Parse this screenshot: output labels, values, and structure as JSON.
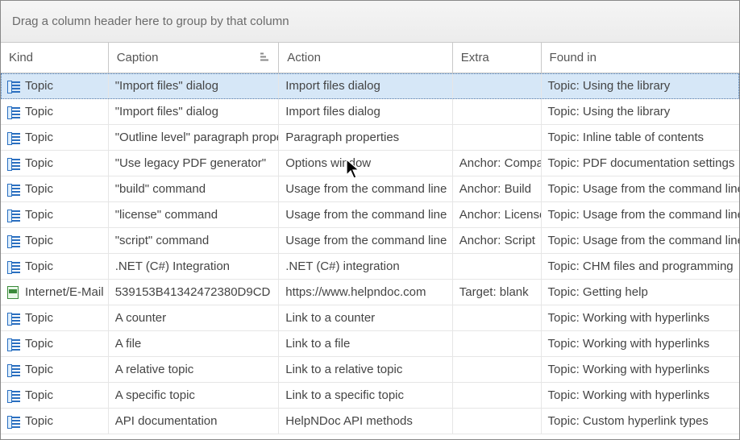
{
  "groupByHint": "Drag a column header here to group by that column",
  "columns": {
    "kind": "Kind",
    "caption": "Caption",
    "action": "Action",
    "extra": "Extra",
    "found": "Found in"
  },
  "rows": [
    {
      "kind": "Topic",
      "icon": "topic",
      "caption": "\"Import files\" dialog",
      "action": "Import files dialog",
      "extra": "",
      "found": "Topic: Using the library",
      "selected": true
    },
    {
      "kind": "Topic",
      "icon": "topic",
      "caption": "\"Import files\" dialog",
      "action": "Import files dialog",
      "extra": "",
      "found": "Topic: Using the library"
    },
    {
      "kind": "Topic",
      "icon": "topic",
      "caption": "\"Outline level\" paragraph property",
      "action": "Paragraph properties",
      "extra": "",
      "found": "Topic: Inline table of contents"
    },
    {
      "kind": "Topic",
      "icon": "topic",
      "caption": "\"Use legacy PDF generator\"",
      "action": "Options window",
      "extra": "Anchor: Compatibility",
      "found": "Topic: PDF documentation settings"
    },
    {
      "kind": "Topic",
      "icon": "topic",
      "caption": "\"build\" command",
      "action": "Usage from the command line",
      "extra": "Anchor: Build",
      "found": "Topic: Usage from the command line"
    },
    {
      "kind": "Topic",
      "icon": "topic",
      "caption": "\"license\" command",
      "action": "Usage from the command line",
      "extra": "Anchor: License",
      "found": "Topic: Usage from the command line"
    },
    {
      "kind": "Topic",
      "icon": "topic",
      "caption": "\"script\" command",
      "action": "Usage from the command line",
      "extra": "Anchor: Script",
      "found": "Topic: Usage from the command line"
    },
    {
      "kind": "Topic",
      "icon": "topic",
      "caption": ".NET (C#) Integration",
      "action": ".NET (C#) integration",
      "extra": "",
      "found": "Topic: CHM files and programming"
    },
    {
      "kind": "Internet/E-Mail",
      "icon": "html",
      "caption": "539153B41342472380D9CD",
      "action": "https://www.helpndoc.com",
      "extra": "Target: blank",
      "found": "Topic: Getting help"
    },
    {
      "kind": "Topic",
      "icon": "topic",
      "caption": "A counter",
      "action": "Link to a counter",
      "extra": "",
      "found": "Topic: Working with hyperlinks"
    },
    {
      "kind": "Topic",
      "icon": "topic",
      "caption": "A file",
      "action": "Link to a file",
      "extra": "",
      "found": "Topic: Working with hyperlinks"
    },
    {
      "kind": "Topic",
      "icon": "topic",
      "caption": "A relative topic",
      "action": "Link to a relative topic",
      "extra": "",
      "found": "Topic: Working with hyperlinks"
    },
    {
      "kind": "Topic",
      "icon": "topic",
      "caption": "A specific topic",
      "action": "Link to a specific topic",
      "extra": "",
      "found": "Topic: Working with hyperlinks"
    },
    {
      "kind": "Topic",
      "icon": "topic",
      "caption": "API documentation",
      "action": "HelpNDoc API methods",
      "extra": "",
      "found": "Topic: Custom hyperlink types"
    }
  ]
}
